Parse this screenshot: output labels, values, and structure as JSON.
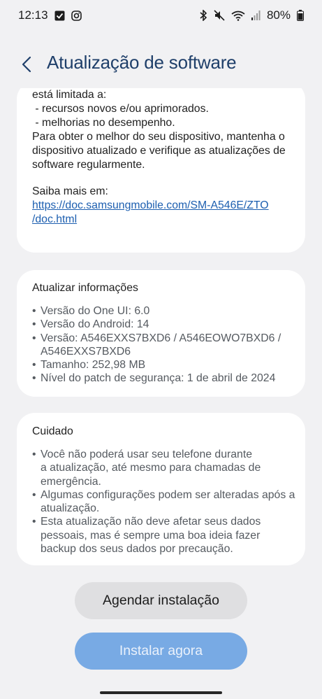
{
  "status_bar": {
    "time": "12:13",
    "battery": "80%",
    "left_icons": [
      "check-square-icon",
      "instagram-icon"
    ],
    "right_icons": [
      "bluetooth-icon",
      "mute-icon",
      "wifi-icon",
      "signal-icon",
      "battery-icon"
    ]
  },
  "header": {
    "title": "Atualização de software"
  },
  "release_notes": {
    "intro_partial": "está limitada a:",
    "items": [
      " - recursos novos e/ou aprimorados.",
      " - melhorias no desempenho."
    ],
    "paragraph_lines": [
      "Para obter o melhor do seu dispositivo, mantenha o",
      "dispositivo atualizado e verifique as atualizações de",
      "software regularmente."
    ],
    "learn_more": "Saiba mais em:",
    "link_lines": [
      "https://doc.samsungmobile.com/SM-A546E/ZTO",
      "/doc.html"
    ]
  },
  "update_info": {
    "title": "Atualizar informações",
    "items": [
      "Versão do One UI: 6.0",
      "Versão do Android: 14",
      "Versão: A546EXXS7BXD6 / A546EOWO7BXD6 /",
      "Tamanho: 252,98 MB",
      "Nível do patch de segurança: 1 de abril de 2024"
    ],
    "version_cont": "A546EXXS7BXD6"
  },
  "caution": {
    "title": "Cuidado",
    "items": [
      {
        "line1": "Você não poderá usar seu telefone durante",
        "line2": "a atualização, até mesmo para chamadas de",
        "line3": "emergência."
      },
      {
        "line1": "Algumas configurações podem ser alteradas após a",
        "line2": "atualização."
      },
      {
        "line1": "Esta atualização não deve afetar seus dados",
        "line2": "pessoais, mas é sempre uma boa ideia fazer",
        "line3": "backup dos seus dados por precaução."
      }
    ]
  },
  "buttons": {
    "schedule": "Agendar instalação",
    "install": "Instalar agora"
  },
  "colors": {
    "title": "#1f3f6a",
    "link": "#1d5fb0",
    "install_button": "#78aae4"
  }
}
